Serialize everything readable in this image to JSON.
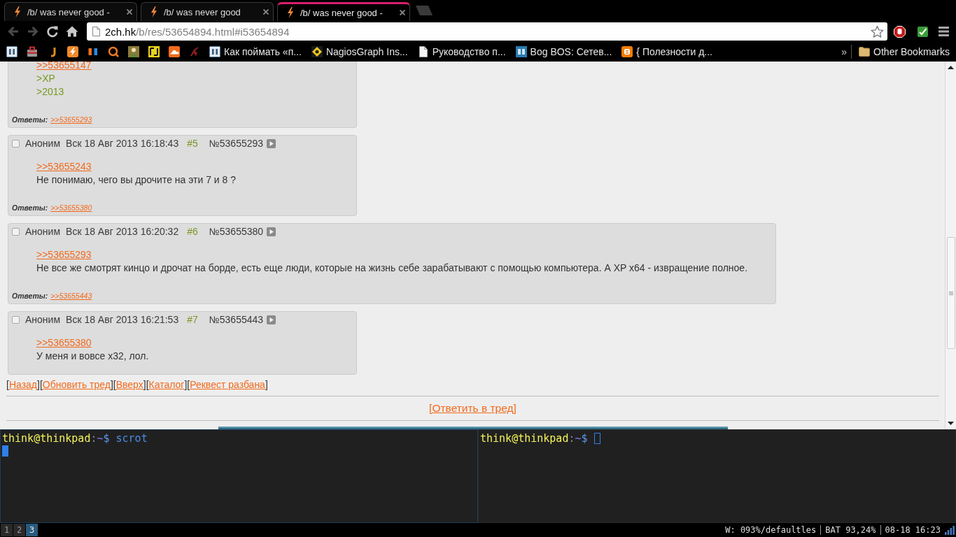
{
  "browser": {
    "tabs": [
      {
        "title": "/b/ was never good -",
        "selected": false
      },
      {
        "title": "/b/ was never good",
        "selected": false
      },
      {
        "title": "/b/ was never good -",
        "selected": true
      }
    ],
    "address": {
      "host": "2ch.hk",
      "path": "/b/res/53654894.html#i53654894"
    },
    "bookmarks": [
      {
        "label": "Как поймать «п..."
      },
      {
        "label": "NagiosGraph Ins..."
      },
      {
        "label": "Руководство п..."
      },
      {
        "label": "Bog BOS: Сетев..."
      },
      {
        "label": "{ Полезности д..."
      }
    ],
    "more_bookmarks": "»",
    "other_bookmarks": "Other Bookmarks"
  },
  "page": {
    "posts": [
      {
        "body": [
          {
            "kind": "link",
            "text": ">>53655147"
          },
          {
            "kind": "quote",
            "text": ">XP"
          },
          {
            "kind": "quote",
            "text": ">2013"
          }
        ],
        "replies": {
          "label": "Ответы:",
          "links": [
            ">>53655293"
          ]
        }
      },
      {
        "header": {
          "checked": false,
          "name": "Аноним",
          "date": "Вск 18 Авг 2013 16:18:43",
          "index": "#5",
          "number": "№53655293"
        },
        "body": [
          {
            "kind": "link",
            "text": ">>53655243"
          },
          {
            "kind": "text",
            "text": "Не понимаю, чего вы дрочите на эти 7 и 8 ?"
          }
        ],
        "replies": {
          "label": "Ответы:",
          "links": [
            ">>53655380"
          ]
        }
      },
      {
        "header": {
          "checked": false,
          "name": "Аноним",
          "date": "Вск 18 Авг 2013 16:20:32",
          "index": "#6",
          "number": "№53655380"
        },
        "body": [
          {
            "kind": "link",
            "text": ">>53655293"
          },
          {
            "kind": "text",
            "text": "Не все же смотрят кинцо и дрочат на борде, есть еще люди, которые на жизнь себе зарабатывают с помощью компьютера. А XP x64 - извращение полное."
          }
        ],
        "replies": {
          "label": "Ответы:",
          "links": [
            ">>53655443"
          ]
        }
      },
      {
        "header": {
          "checked": false,
          "name": "Аноним",
          "date": "Вск 18 Авг 2013 16:21:53",
          "index": "#7",
          "number": "№53655443"
        },
        "body": [
          {
            "kind": "link",
            "text": ">>53655380"
          },
          {
            "kind": "text",
            "text": "У меня и вовсе x32, лол."
          }
        ]
      }
    ],
    "nav": {
      "open": "[",
      "close": "]",
      "links": [
        "Назад",
        "Обновить тред",
        "Вверх",
        "Каталог",
        "Реквест разбана"
      ]
    },
    "reply_link": "[Ответить в тред]"
  },
  "terminals": [
    {
      "focused": true,
      "prompt": {
        "user": "think@thinkpad",
        "separator": ":",
        "path": "~",
        "symbol": "$"
      },
      "command": "scrot"
    },
    {
      "focused": false,
      "prompt": {
        "user": "think@thinkpad",
        "separator": ":",
        "path": "~",
        "symbol": "$"
      }
    }
  ],
  "status_bar": {
    "workspaces": [
      {
        "label": "1",
        "selected": false
      },
      {
        "label": "2",
        "selected": false
      },
      {
        "label": "3",
        "selected": true
      }
    ],
    "items": [
      "W: 093%/defaultles",
      "BAT 93,24%",
      "08-18 16:23"
    ]
  }
}
